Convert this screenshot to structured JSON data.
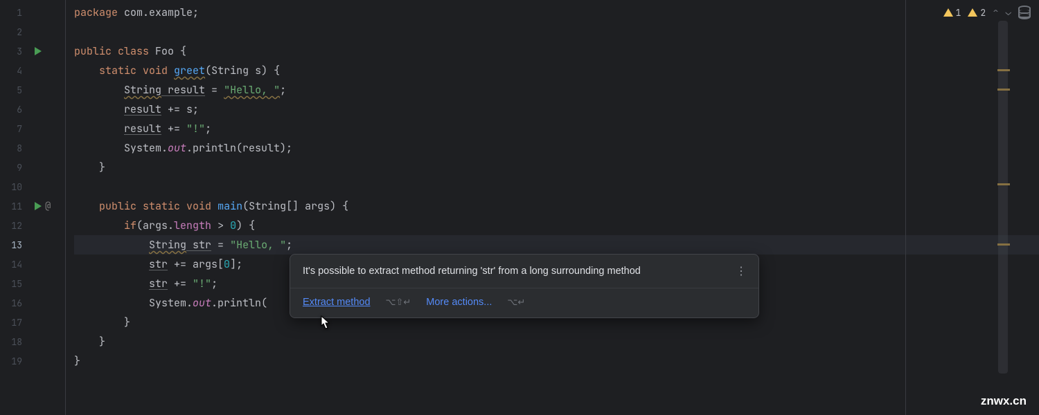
{
  "gutter": {
    "line_count": 19,
    "active_line": 13,
    "run_lines": [
      3,
      11
    ],
    "at_line": 11,
    "bulb_line": 13
  },
  "indicators": {
    "warn1_count": "1",
    "warn2_count": "2"
  },
  "code": {
    "l1_pkg": "package",
    "l1_name": " com.example;",
    "l3_pub": "public ",
    "l3_cls": "class ",
    "l3_name": "Foo ",
    "l3_brace": "{",
    "l4_indent": "    ",
    "l4_static": "static ",
    "l4_void": "void ",
    "l4_method": "greet",
    "l4_sig": "(String s) {",
    "l5_indent": "        ",
    "l5_type": "String",
    "l5_var": " result",
    "l5_eq": " = ",
    "l5_str": "\"Hello, \"",
    "l5_semi": ";",
    "l6_indent": "        ",
    "l6_var": "result",
    "l6_op": " += s;",
    "l7_indent": "        ",
    "l7_var": "result",
    "l7_op": " += ",
    "l7_str": "\"!\"",
    "l7_semi": ";",
    "l8_indent": "        System.",
    "l8_out": "out",
    "l8_rest": ".println(result);",
    "l9": "    }",
    "l11_indent": "    ",
    "l11_pub": "public ",
    "l11_static": "static ",
    "l11_void": "void ",
    "l11_main": "main",
    "l11_sig": "(String[] args) {",
    "l12_indent": "        ",
    "l12_if": "if",
    "l12_cond1": "(args.",
    "l12_len": "length",
    "l12_gt": " > ",
    "l12_zero": "0",
    "l12_end": ") {",
    "l13_indent": "            ",
    "l13_type": "String",
    "l13_var": " str",
    "l13_eq": " = ",
    "l13_str": "\"Hello, \"",
    "l13_semi": ";",
    "l14_indent": "            ",
    "l14_var": "str",
    "l14_op": " += args[",
    "l14_idx": "0",
    "l14_end": "];",
    "l15_indent": "            ",
    "l15_var": "str",
    "l15_op": " += ",
    "l15_str": "\"!\"",
    "l15_semi": ";",
    "l16_indent": "            System.",
    "l16_out": "out",
    "l16_rest": ".println(",
    "l17": "        }",
    "l18": "    }",
    "l19": "}"
  },
  "popup": {
    "title": "It's possible to extract method returning 'str' from a long surrounding method",
    "action_primary": "Extract method",
    "shortcut_primary": "⌥⇧↵",
    "action_more": "More actions...",
    "shortcut_more": "⌥↵"
  },
  "watermark": "znwx.cn"
}
